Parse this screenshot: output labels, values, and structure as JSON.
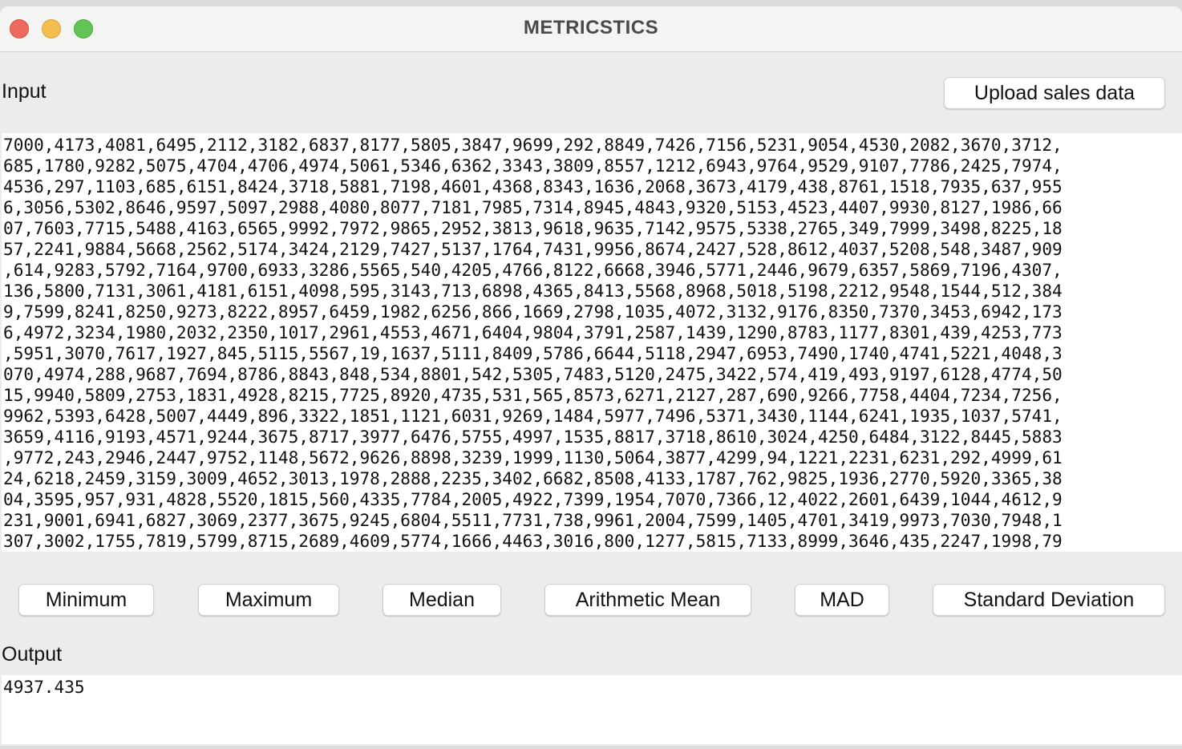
{
  "window": {
    "title": "METRICSTICS"
  },
  "input": {
    "label": "Input",
    "upload_button_label": "Upload sales data",
    "lines": [
      "7000,4173,4081,6495,2112,3182,6837,8177,5805,3847,9699,292,8849,7426,7156,5231,9054,4530,2082,3670,3712,",
      "685,1780,9282,5075,4704,4706,4974,5061,5346,6362,3343,3809,8557,1212,6943,9764,9529,9107,7786,2425,7974,",
      "4536,297,1103,685,6151,8424,3718,5881,7198,4601,4368,8343,1636,2068,3673,4179,438,8761,1518,7935,637,955",
      "6,3056,5302,8646,9597,5097,2988,4080,8077,7181,7985,7314,8945,4843,9320,5153,4523,4407,9930,8127,1986,66",
      "07,7603,7715,5488,4163,6565,9992,7972,9865,2952,3813,9618,9635,7142,9575,5338,2765,349,7999,3498,8225,18",
      "57,2241,9884,5668,2562,5174,3424,2129,7427,5137,1764,7431,9956,8674,2427,528,8612,4037,5208,548,3487,909",
      ",614,9283,5792,7164,9700,6933,3286,5565,540,4205,4766,8122,6668,3946,5771,2446,9679,6357,5869,7196,4307,",
      "136,5800,7131,3061,4181,6151,4098,595,3143,713,6898,4365,8413,5568,8968,5018,5198,2212,9548,1544,512,384",
      "9,7599,8241,8250,9273,8222,8957,6459,1982,6256,866,1669,2798,1035,4072,3132,9176,8350,7370,3453,6942,173",
      "6,4972,3234,1980,2032,2350,1017,2961,4553,4671,6404,9804,3791,2587,1439,1290,8783,1177,8301,439,4253,773",
      ",5951,3070,7617,1927,845,5115,5567,19,1637,5111,8409,5786,6644,5118,2947,6953,7490,1740,4741,5221,4048,3",
      "070,4974,288,9687,7694,8786,8843,848,534,8801,542,5305,7483,5120,2475,3422,574,419,493,9197,6128,4774,50",
      "15,9940,5809,2753,1831,4928,8215,7725,8920,4735,531,565,8573,6271,2127,287,690,9266,7758,4404,7234,7256,",
      "9962,5393,6428,5007,4449,896,3322,1851,1121,6031,9269,1484,5977,7496,5371,3430,1144,6241,1935,1037,5741,",
      "3659,4116,9193,4571,9244,3675,8717,3977,6476,5755,4997,1535,8817,3718,8610,3024,4250,6484,3122,8445,5883",
      ",9772,243,2946,2447,9752,1148,5672,9626,8898,3239,1999,1130,5064,3877,4299,94,1221,2231,6231,292,4999,61",
      "24,6218,2459,3159,3009,4652,3013,1978,2888,2235,3402,6682,8508,4133,1787,762,9825,1936,2770,5920,3365,38",
      "04,3595,957,931,4828,5520,1815,560,4335,7784,2005,4922,7399,1954,7070,7366,12,4022,2601,6439,1044,4612,9",
      "231,9001,6941,6827,3069,2377,3675,9245,6804,5511,7731,738,9961,2004,7599,1405,4701,3419,9973,7030,7948,1",
      "307,3002,1755,7819,5799,8715,2689,4609,5774,1666,4463,3016,800,1277,5815,7133,8999,3646,435,2247,1998,79"
    ]
  },
  "metrics": {
    "minimum": "Minimum",
    "maximum": "Maximum",
    "median": "Median",
    "mean": "Arithmetic Mean",
    "mad": "MAD",
    "std": "Standard Deviation"
  },
  "output": {
    "label": "Output",
    "value": "4937.435"
  },
  "colors": {
    "close": "#ed6a5e",
    "minimize": "#f5bf4f",
    "zoom": "#61c554"
  }
}
